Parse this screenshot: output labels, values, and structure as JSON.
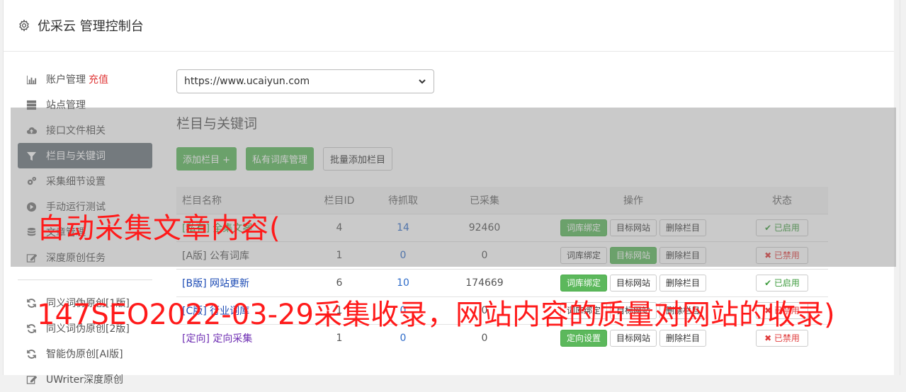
{
  "app": {
    "title": "优采云 管理控制台"
  },
  "sidebar": {
    "items": [
      {
        "label": "账户管理",
        "extra": "充值",
        "icon": "bar-chart-icon"
      },
      {
        "label": "站点管理",
        "icon": "server-icon"
      },
      {
        "label": "接口文件相关",
        "icon": "cloud-upload-icon"
      },
      {
        "label": "栏目与关键词",
        "icon": "filter-icon",
        "active": true
      },
      {
        "label": "采集细节设置",
        "icon": "gears-icon"
      },
      {
        "label": "手动运行测试",
        "icon": "play-circle-icon"
      },
      {
        "label": "文章管理",
        "icon": "database-icon"
      },
      {
        "label": "深度原创任务",
        "icon": "edit-icon"
      }
    ],
    "items2": [
      {
        "label": "同义词伪原创[1版]",
        "icon": "refresh-icon"
      },
      {
        "label": "同义词伪原创[2版]",
        "icon": "refresh-icon"
      },
      {
        "label": "智能伪原创[AI版]",
        "icon": "refresh-icon"
      },
      {
        "label": "UWriter深度原创",
        "icon": "edit-icon"
      }
    ]
  },
  "main": {
    "site_select": "https://www.ucaiyun.com",
    "section_title": "栏目与关键词",
    "buttons": {
      "add": "添加栏目 +",
      "private": "私有词库管理",
      "batch": "批量添加栏目"
    },
    "table": {
      "headers": [
        "栏目名称",
        "栏目ID",
        "待抓取",
        "已采集",
        "操作",
        "状态"
      ],
      "rows": [
        {
          "name": "[私有] 全集文案",
          "color": "green",
          "id": "4",
          "pending": "14",
          "collected": "92460",
          "op1": "词库绑定",
          "op1_green": true,
          "op2": "目标网站",
          "op2_green": false,
          "op3": "删除栏目",
          "status": "✔ 已启用",
          "on": true
        },
        {
          "name": "[A版] 公有词库",
          "color": "gray",
          "id": "1",
          "pending": "0",
          "collected": "0",
          "op1": "词库绑定",
          "op1_green": false,
          "op2": "目标网站",
          "op2_green": true,
          "op3": "删除栏目",
          "status": "✖ 已禁用",
          "on": false
        },
        {
          "name": "[B版] 网站更新",
          "color": "blue",
          "id": "6",
          "pending": "10",
          "collected": "174669",
          "op1": "词库绑定",
          "op1_green": true,
          "op2": "目标网站",
          "op2_green": false,
          "op3": "删除栏目",
          "status": "✔ 已启用",
          "on": true
        },
        {
          "name": "[C版] 行业词库",
          "color": "blue",
          "id": "1",
          "pending": "0",
          "collected": "0",
          "op1": "词库绑定",
          "op1_green": false,
          "op2": "目标网站",
          "op2_green": false,
          "op3": "删除栏目",
          "status": "✖ 已禁用",
          "on": false
        },
        {
          "name": "[定向] 定向采集",
          "color": "purple",
          "id": "1",
          "pending": "0",
          "collected": "0",
          "op1": "定向设置",
          "op1_green": true,
          "op2": "目标网站",
          "op2_green": false,
          "op3": "删除栏目",
          "status": "✖ 已禁用",
          "on": false
        }
      ]
    }
  },
  "captions": {
    "line1": "自动采集文章内容(",
    "line2": "147SEO2022-03-29采集收录，网站内容的质量对网站的收录)"
  },
  "colors": {
    "green": "#5cb85c",
    "active_nav": "#6c757d",
    "caption": "#ff1a1a"
  }
}
